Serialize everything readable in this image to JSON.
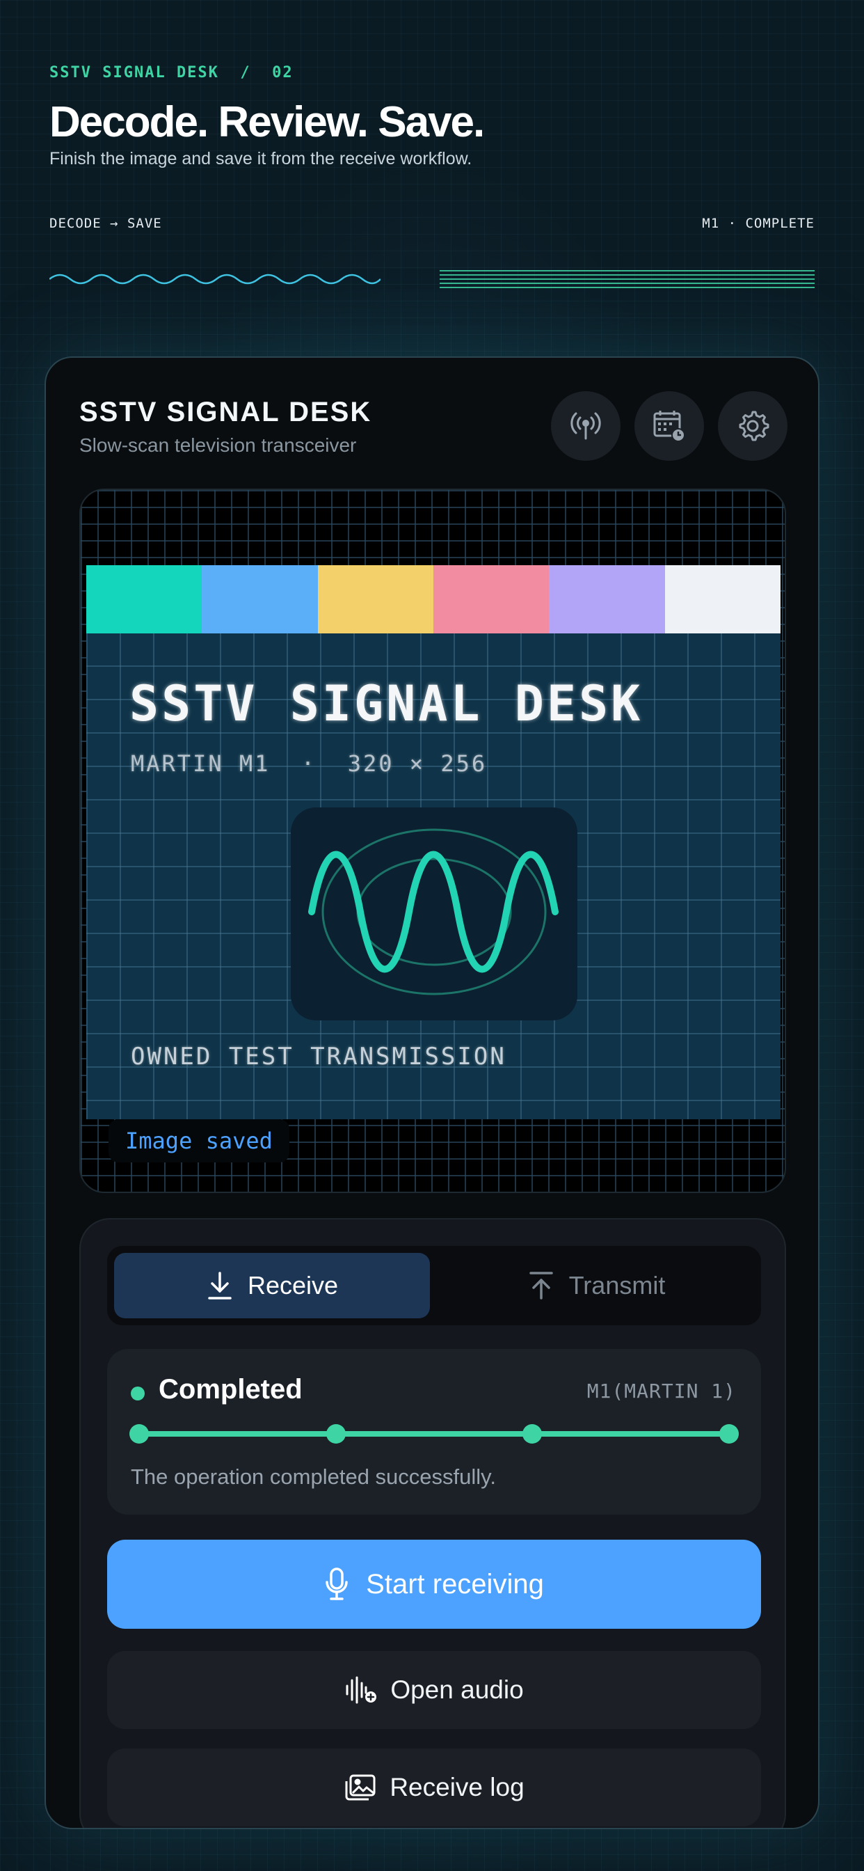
{
  "header": {
    "eyebrow": "SSTV SIGNAL DESK  /  02",
    "headline": "Decode. Review. Save.",
    "subline": "Finish the image and save it from the receive workflow.",
    "flow_left": "DECODE → SAVE",
    "flow_right": "M1 · COMPLETE"
  },
  "app": {
    "title": "SSTV SIGNAL DESK",
    "subtitle": "Slow-scan television transceiver",
    "icons": [
      "antenna-icon",
      "calendar-schedule-icon",
      "gear-icon"
    ]
  },
  "preview": {
    "color_bars": [
      "#14d6bd",
      "#5aaff8",
      "#f3d06a",
      "#f28ca0",
      "#b2a4f6",
      "#eef2f7"
    ],
    "image_title": "SSTV SIGNAL DESK",
    "image_meta": "MARTIN M1  ·  320 × 256",
    "image_footer": "OWNED TEST TRANSMISSION",
    "saved_badge": "Image saved"
  },
  "controls": {
    "tabs": [
      {
        "label": "Receive",
        "icon": "download-icon",
        "active": true
      },
      {
        "label": "Transmit",
        "icon": "upload-icon",
        "active": false
      }
    ],
    "status": {
      "label": "Completed",
      "mode": "M1(MARTIN 1)",
      "message": "The operation completed successfully.",
      "progress": 1.0,
      "steps": 4
    },
    "primary_button": "Start receiving",
    "open_audio_button": "Open audio",
    "receive_log_button": "Receive log"
  },
  "colors": {
    "accent_green": "#3fd4a3",
    "accent_blue": "#4da2ff",
    "active_tab": "#1d3656"
  }
}
